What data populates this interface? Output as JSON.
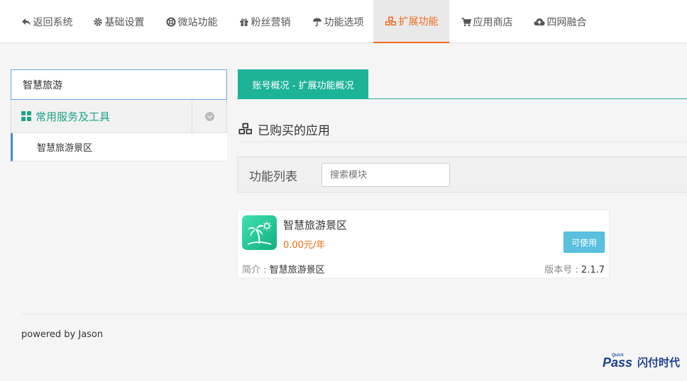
{
  "nav": {
    "items": [
      {
        "label": "返回系统",
        "icon": "reply-icon"
      },
      {
        "label": "基础设置",
        "icon": "gear-icon"
      },
      {
        "label": "微站功能",
        "icon": "life-ring-icon"
      },
      {
        "label": "粉丝营销",
        "icon": "gift-icon"
      },
      {
        "label": "功能选项",
        "icon": "umbrella-icon"
      },
      {
        "label": "扩展功能",
        "icon": "cubes-icon",
        "active": true
      },
      {
        "label": "应用商店",
        "icon": "cart-icon"
      },
      {
        "label": "四网融合",
        "icon": "cloud-upload-icon"
      }
    ],
    "active_color": "#ee6b1f"
  },
  "sidebar": {
    "search_value": "智慧旅游",
    "group": {
      "title": "常用服务及工具",
      "items": [
        {
          "label": "智慧旅游景区"
        }
      ]
    },
    "accent": "#1ea387"
  },
  "main": {
    "tab_label": "账号概况 - 扩展功能概况",
    "section_title": "已购买的应用",
    "filter_label": "功能列表",
    "search_placeholder": "搜索模块",
    "tab_color": "#1db398",
    "apps": [
      {
        "name": "智慧旅游景区",
        "price": "0.00元/年",
        "action_label": "可使用",
        "desc_label": "简介 : ",
        "desc_value": "智慧旅游景区",
        "version_label": "版本号 : ",
        "version_value": "2.1.7"
      }
    ]
  },
  "footer": {
    "text": "powered by Jason"
  },
  "logo": {
    "text_pass": "Pass",
    "text_brand": "闪付时代",
    "text_small": "Quick"
  }
}
